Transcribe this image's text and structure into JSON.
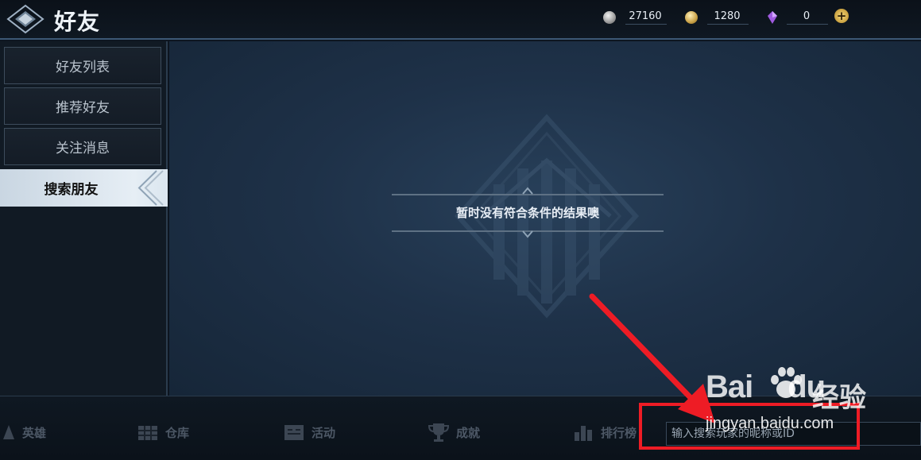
{
  "header": {
    "title": "好友",
    "back_icon": "diamond-back-icon",
    "currencies": [
      {
        "icon": "silver-coin-icon",
        "amount": "27160"
      },
      {
        "icon": "gold-coin-icon",
        "amount": "1280"
      },
      {
        "icon": "purple-crystal-icon",
        "amount": "0"
      }
    ],
    "add_icon": "plus-icon",
    "add_symbol": "+"
  },
  "sidebar": {
    "items": [
      {
        "label": "好友列表",
        "active": false
      },
      {
        "label": "推荐好友",
        "active": false
      },
      {
        "label": "关注消息",
        "active": false
      },
      {
        "label": "搜索朋友",
        "active": true
      }
    ]
  },
  "main": {
    "empty_message": "暂时没有符合条件的结果噢"
  },
  "bottom_nav": {
    "items": [
      {
        "label": "英雄",
        "icon": "hero-icon"
      },
      {
        "label": "仓库",
        "icon": "warehouse-icon"
      },
      {
        "label": "活动",
        "icon": "activity-icon"
      },
      {
        "label": "成就",
        "icon": "trophy-icon"
      },
      {
        "label": "排行榜",
        "icon": "ranking-icon"
      }
    ]
  },
  "search": {
    "placeholder": "输入搜索玩家的昵称或ID"
  },
  "annotation": {
    "color": "#ee1c25",
    "watermark_brand": "Bai",
    "watermark_brand_end": "du",
    "watermark_cn": "经验",
    "watermark_url": "jingyan.baidu.com"
  }
}
